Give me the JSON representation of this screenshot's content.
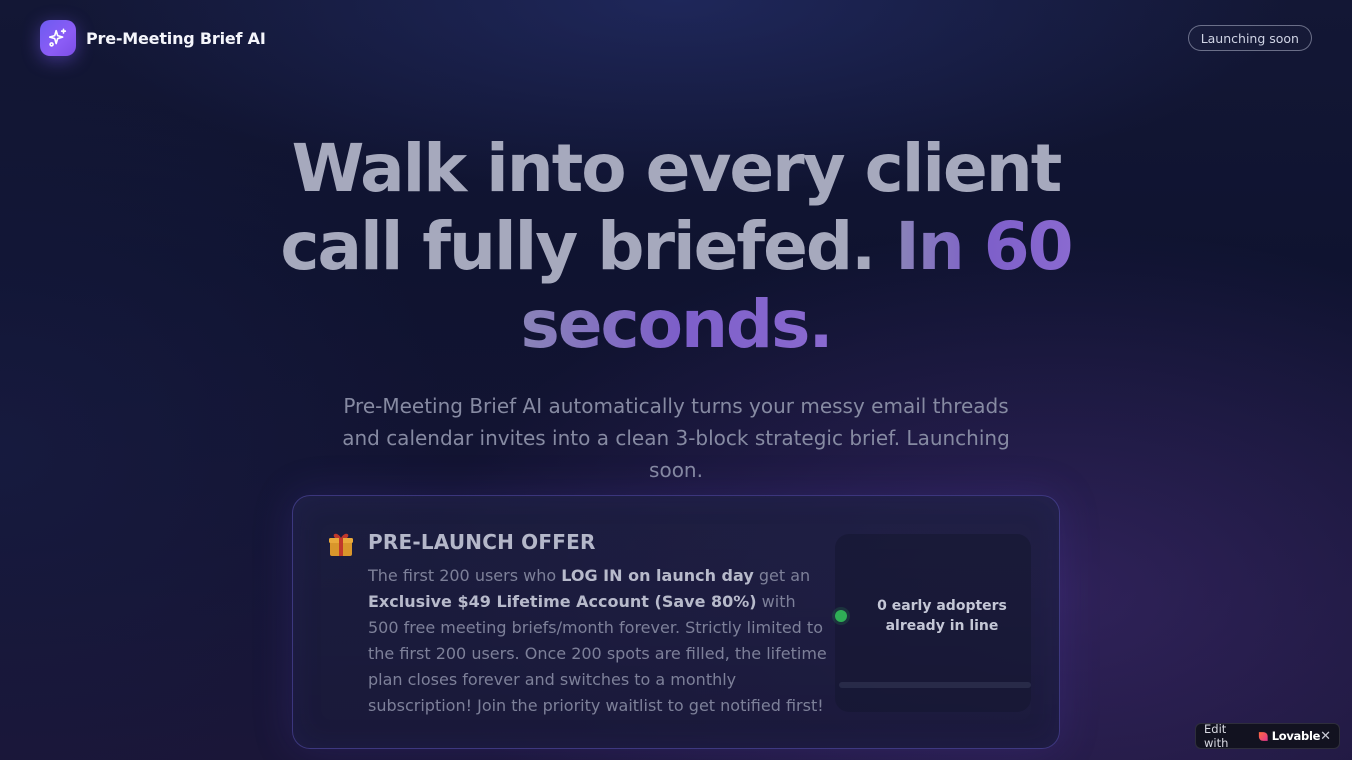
{
  "header": {
    "brand_name": "Pre-Meeting Brief AI",
    "logo_icon": "sparkles-icon",
    "status_pill": "Launching soon"
  },
  "hero": {
    "title_line1": "Walk into every client",
    "title_line2_main": "call fully briefed.",
    "title_line2_accent": "In 60",
    "title_line3_accent": "seconds.",
    "subtitle": "Pre-Meeting Brief AI automatically turns your messy email threads and calendar invites into a clean 3-block strategic brief. Launching soon."
  },
  "offer": {
    "icon": "gift-icon",
    "title": "PRE-LAUNCH OFFER",
    "body": {
      "p1": "The first 200 users who ",
      "b1": "LOG IN on launch day",
      "p2": " get an ",
      "b2": "Exclusive $49 Lifetime Account (Save 80%)",
      "p3": " with 500 free meeting briefs/month forever. Strictly limited to the first 200 users. Once 200 spots are filled, the lifetime plan closes forever and switches to a monthly subscription! Join the priority waitlist to get notified first!"
    },
    "counter": {
      "text": "0 early adopters already in line",
      "status_color": "#2fae56",
      "progress_fraction": 0
    }
  },
  "badge": {
    "edit_label": "Edit with",
    "brand": "Lovable",
    "close": "✕"
  },
  "colors": {
    "accent": "#8b5cf6",
    "background": "#0f1330"
  }
}
